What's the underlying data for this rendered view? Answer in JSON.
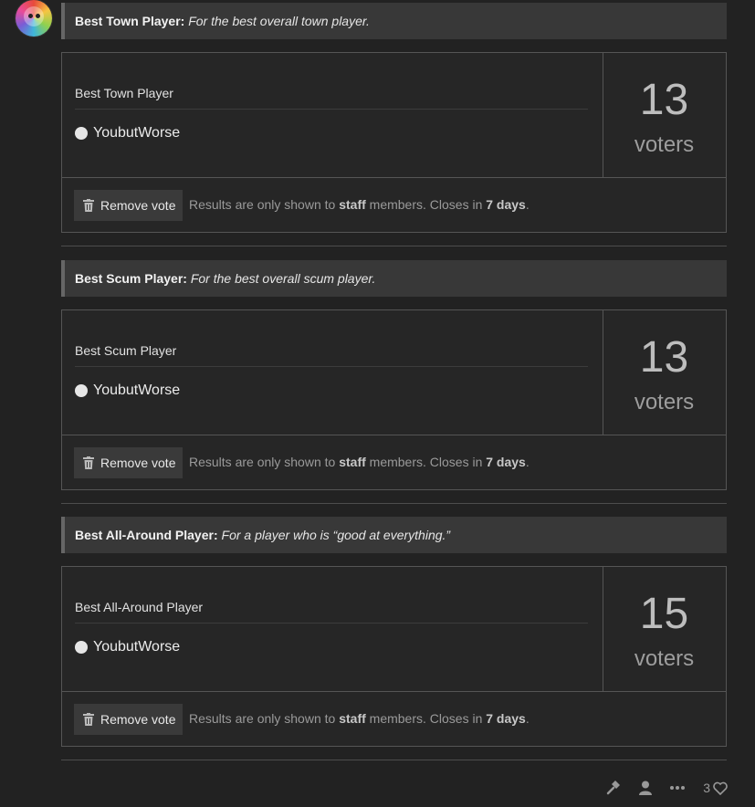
{
  "polls": [
    {
      "heading_title": "Best Town Player:",
      "heading_desc": "For the best overall town player.",
      "box_title": "Best Town Player",
      "option": "YoubutWorse",
      "voters": "13",
      "voters_label": "voters",
      "remove_label": "Remove vote",
      "info_prefix": "Results are only shown to ",
      "info_staff": "staff",
      "info_mid": " members.  Closes in ",
      "info_days": "7 days",
      "info_suffix": "."
    },
    {
      "heading_title": "Best Scum Player:",
      "heading_desc": "For the best overall scum player.",
      "box_title": "Best Scum Player",
      "option": "YoubutWorse",
      "voters": "13",
      "voters_label": "voters",
      "remove_label": "Remove vote",
      "info_prefix": "Results are only shown to ",
      "info_staff": "staff",
      "info_mid": " members.  Closes in ",
      "info_days": "7 days",
      "info_suffix": "."
    },
    {
      "heading_title": "Best All-Around Player:",
      "heading_desc": "For a player who is “good at everything.”",
      "box_title": "Best All-Around Player",
      "option": "YoubutWorse",
      "voters": "15",
      "voters_label": "voters",
      "remove_label": "Remove vote",
      "info_prefix": "Results are only shown to ",
      "info_staff": "staff",
      "info_mid": " members.  Closes in ",
      "info_days": "7 days",
      "info_suffix": "."
    }
  ],
  "post_actions": {
    "icons": [
      "hammer-icon",
      "user-icon",
      "more-icon",
      "heart-icon"
    ],
    "like_count": "3"
  },
  "colors": {
    "background": "#222222",
    "heading_bg": "#383838",
    "border": "#555555"
  }
}
